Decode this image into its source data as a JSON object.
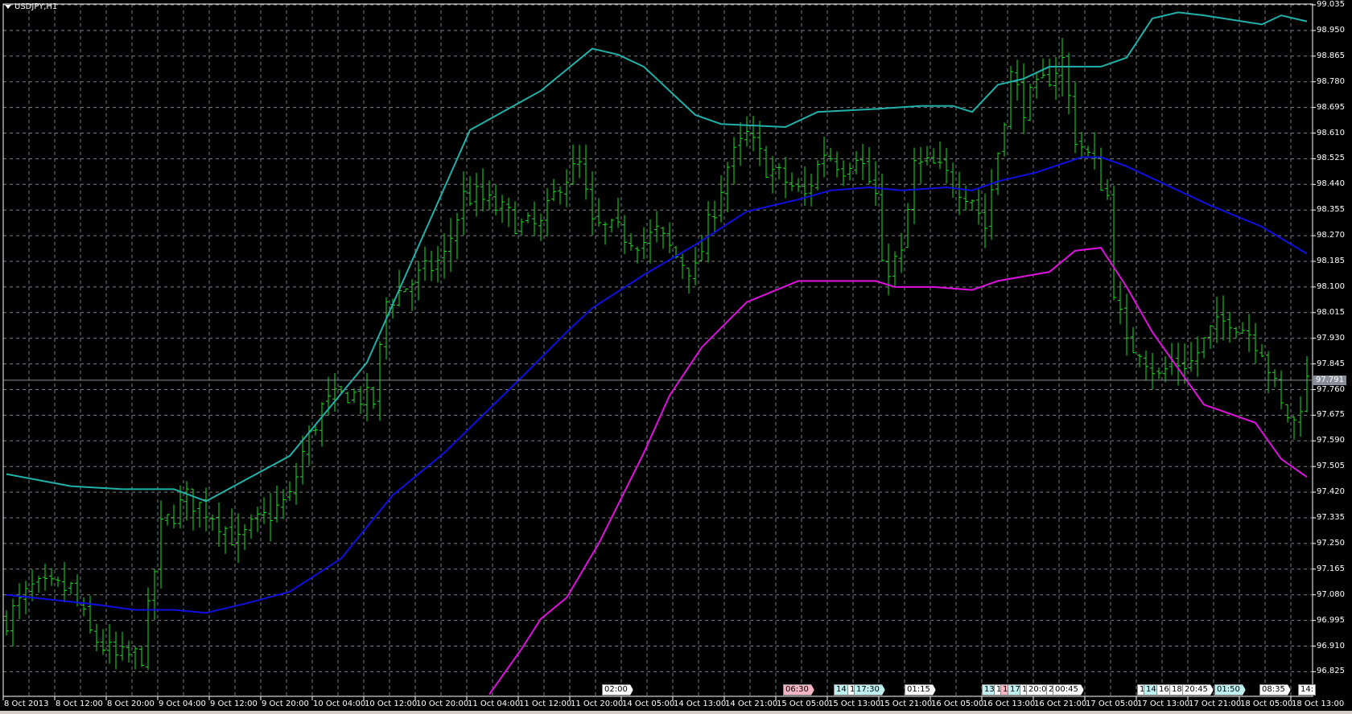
{
  "chart_title": "USDJPY,H1",
  "current_price": "97.791",
  "colors": {
    "bars": "#22dd22",
    "upper_band": "#20b2aa",
    "middle_band": "#1010e0",
    "lower_band": "#e010e0",
    "grid": "#7a7f87",
    "price_line": "#8a8f9a"
  },
  "price_axis": [
    "99.035",
    "98.950",
    "98.865",
    "98.780",
    "98.695",
    "98.610",
    "98.525",
    "98.440",
    "98.355",
    "98.270",
    "98.185",
    "98.100",
    "98.015",
    "97.930",
    "97.845",
    "97.760",
    "97.675",
    "97.590",
    "97.505",
    "97.420",
    "97.335",
    "97.250",
    "97.165",
    "97.080",
    "96.995",
    "96.910",
    "96.825"
  ],
  "time_axis": [
    "8 Oct 2013",
    "8 Oct 12:00",
    "8 Oct 20:00",
    "9 Oct 04:00",
    "9 Oct 12:00",
    "9 Oct 20:00",
    "10 Oct 04:00",
    "10 Oct 12:00",
    "10 Oct 20:00",
    "11 Oct 04:00",
    "11 Oct 12:00",
    "11 Oct 20:00",
    "14 Oct 05:00",
    "14 Oct 13:00",
    "14 Oct 21:00",
    "15 Oct 05:00",
    "15 Oct 13:00",
    "15 Oct 21:00",
    "16 Oct 05:00",
    "16 Oct 13:00",
    "16 Oct 21:00",
    "17 Oct 05:00",
    "17 Oct 13:00",
    "17 Oct 21:00",
    "18 Oct 05:00",
    "18 Oct 13:00"
  ],
  "events": [
    "02:00",
    "06:30",
    "14:",
    "1",
    "17:30",
    "01:15",
    "13:",
    "1",
    "1",
    "17:",
    "1",
    "20:0",
    "2",
    "00:45",
    "1",
    "14:",
    "16:",
    "18:",
    "20:45",
    "01:50",
    "08:35",
    "14:"
  ],
  "chart_data": {
    "type": "ohlc",
    "symbol": "USDJPY",
    "timeframe": "H1",
    "ylim": [
      96.825,
      99.035
    ],
    "bar_count": 203,
    "close_keypoints": [
      [
        0,
        97.0
      ],
      [
        4,
        97.1
      ],
      [
        10,
        97.1
      ],
      [
        13,
        96.95
      ],
      [
        17,
        96.87
      ],
      [
        21,
        96.88
      ],
      [
        24,
        97.3
      ],
      [
        28,
        97.4
      ],
      [
        32,
        97.35
      ],
      [
        36,
        97.25
      ],
      [
        38,
        97.3
      ],
      [
        41,
        97.35
      ],
      [
        44,
        97.4
      ],
      [
        46,
        97.55
      ],
      [
        49,
        97.7
      ],
      [
        53,
        97.75
      ],
      [
        57,
        97.72
      ],
      [
        59,
        98.05
      ],
      [
        62,
        98.1
      ],
      [
        65,
        98.15
      ],
      [
        68,
        98.2
      ],
      [
        71,
        98.4
      ],
      [
        73,
        98.4
      ],
      [
        77,
        98.35
      ],
      [
        80,
        98.3
      ],
      [
        83,
        98.3
      ],
      [
        86,
        98.45
      ],
      [
        89,
        98.5
      ],
      [
        91,
        98.3
      ],
      [
        95,
        98.28
      ],
      [
        99,
        98.25
      ],
      [
        101,
        98.28
      ],
      [
        104,
        98.2
      ],
      [
        107,
        98.15
      ],
      [
        109,
        98.3
      ],
      [
        112,
        98.5
      ],
      [
        115,
        98.6
      ],
      [
        118,
        98.5
      ],
      [
        121,
        98.45
      ],
      [
        124,
        98.4
      ],
      [
        127,
        98.55
      ],
      [
        130,
        98.5
      ],
      [
        132,
        98.55
      ],
      [
        135,
        98.4
      ],
      [
        136,
        98.15
      ],
      [
        139,
        98.2
      ],
      [
        141,
        98.5
      ],
      [
        144,
        98.5
      ],
      [
        147,
        98.45
      ],
      [
        150,
        98.4
      ],
      [
        152,
        98.3
      ],
      [
        154,
        98.55
      ],
      [
        156,
        98.8
      ],
      [
        158,
        98.7
      ],
      [
        160,
        98.75
      ],
      [
        162,
        98.8
      ],
      [
        164,
        98.85
      ],
      [
        166,
        98.6
      ],
      [
        169,
        98.5
      ],
      [
        171,
        98.4
      ],
      [
        172,
        98.1
      ],
      [
        174,
        97.9
      ],
      [
        176,
        97.9
      ],
      [
        179,
        97.8
      ],
      [
        181,
        97.85
      ],
      [
        184,
        97.85
      ],
      [
        187,
        97.95
      ],
      [
        190,
        98.0
      ],
      [
        193,
        97.95
      ],
      [
        195,
        97.9
      ],
      [
        198,
        97.7
      ],
      [
        200,
        97.65
      ],
      [
        202,
        97.79
      ]
    ],
    "bollinger_upper": [
      [
        0,
        97.48
      ],
      [
        10,
        97.44
      ],
      [
        18,
        97.43
      ],
      [
        26,
        97.43
      ],
      [
        31,
        97.39
      ],
      [
        44,
        97.54
      ],
      [
        56,
        97.85
      ],
      [
        72,
        98.62
      ],
      [
        83,
        98.75
      ],
      [
        91,
        98.89
      ],
      [
        95,
        98.87
      ],
      [
        99,
        98.83
      ],
      [
        107,
        98.67
      ],
      [
        111,
        98.64
      ],
      [
        121,
        98.63
      ],
      [
        126,
        98.68
      ],
      [
        135,
        98.69
      ],
      [
        142,
        98.7
      ],
      [
        147,
        98.7
      ],
      [
        150,
        98.68
      ],
      [
        154,
        98.77
      ],
      [
        158,
        98.79
      ],
      [
        162,
        98.83
      ],
      [
        170,
        98.83
      ],
      [
        174,
        98.86
      ],
      [
        178,
        98.99
      ],
      [
        182,
        99.01
      ],
      [
        186,
        99.0
      ],
      [
        195,
        98.97
      ],
      [
        198,
        99.0
      ],
      [
        202,
        98.98
      ]
    ],
    "bollinger_middle": [
      [
        0,
        97.08
      ],
      [
        13,
        97.05
      ],
      [
        20,
        97.03
      ],
      [
        26,
        97.03
      ],
      [
        31,
        97.02
      ],
      [
        37,
        97.05
      ],
      [
        44,
        97.09
      ],
      [
        52,
        97.2
      ],
      [
        60,
        97.41
      ],
      [
        68,
        97.55
      ],
      [
        80,
        97.8
      ],
      [
        87,
        97.95
      ],
      [
        91,
        98.03
      ],
      [
        99,
        98.14
      ],
      [
        107,
        98.24
      ],
      [
        115,
        98.35
      ],
      [
        123,
        98.39
      ],
      [
        128,
        98.42
      ],
      [
        134,
        98.43
      ],
      [
        139,
        98.42
      ],
      [
        146,
        98.43
      ],
      [
        150,
        98.42
      ],
      [
        154,
        98.45
      ],
      [
        160,
        98.48
      ],
      [
        167,
        98.53
      ],
      [
        170,
        98.53
      ],
      [
        174,
        98.5
      ],
      [
        179,
        98.45
      ],
      [
        187,
        98.37
      ],
      [
        195,
        98.3
      ],
      [
        202,
        98.21
      ]
    ],
    "bollinger_lower": [
      [
        75,
        96.75
      ],
      [
        80,
        96.9
      ],
      [
        83,
        97.0
      ],
      [
        87,
        97.07
      ],
      [
        92,
        97.25
      ],
      [
        99,
        97.55
      ],
      [
        103,
        97.74
      ],
      [
        108,
        97.9
      ],
      [
        115,
        98.05
      ],
      [
        123,
        98.12
      ],
      [
        135,
        98.12
      ],
      [
        138,
        98.1
      ],
      [
        144,
        98.1
      ],
      [
        150,
        98.09
      ],
      [
        154,
        98.12
      ],
      [
        162,
        98.15
      ],
      [
        166,
        98.22
      ],
      [
        170,
        98.23
      ],
      [
        174,
        98.1
      ],
      [
        178,
        97.95
      ],
      [
        182,
        97.83
      ],
      [
        186,
        97.71
      ],
      [
        194,
        97.65
      ],
      [
        198,
        97.53
      ],
      [
        202,
        97.47
      ]
    ]
  }
}
